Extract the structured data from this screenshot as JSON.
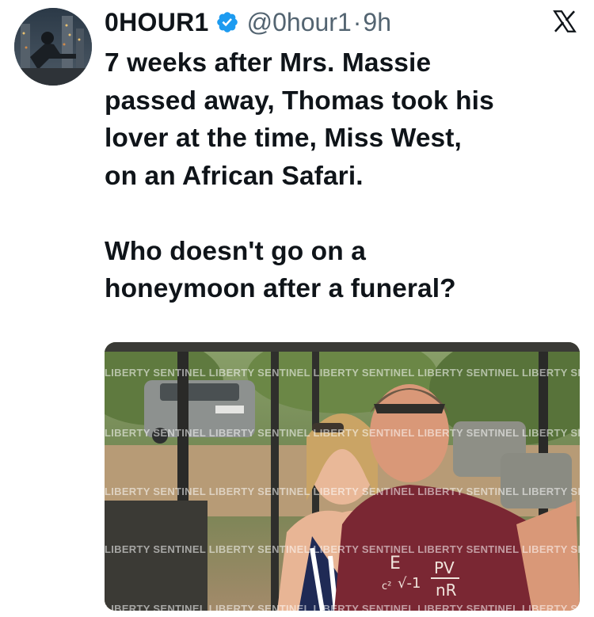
{
  "author": {
    "display_name": "0HOUR1",
    "handle": "@0hour1",
    "separator": "·",
    "time": "9h",
    "verified": true
  },
  "tweet": {
    "text": "7 weeks after Mrs. Massie\npassed away, Thomas took his\nlover at the time, Miss West,\non an African Safari.\n\nWho doesn't go on a\nhoneymoon after a funeral?"
  },
  "media": {
    "watermark_rows": [
      "LIBERTY SENTINEL  LIBERTY SENTINEL  LIBERTY SENTINEL  LIBERTY SENTINEL  LIBERTY SENTI",
      "LIBERTY SENTINEL  LIBERTY SENTINEL  LIBERTY SENTINEL  LIBERTY SENTINEL  LIBERTY SENTI",
      "LIBERTY SENTINEL  LIBERTY SENTINEL  LIBERTY SENTINEL  LIBERTY SENTINEL  LIBERTY SENTI",
      "LIBERTY SENTINEL  LIBERTY SENTINEL  LIBERTY SENTINEL  LIBERTY SENTINEL  LIBERTY SENTI",
      "LIBERTY SENTINEL  LIBERTY SENTINEL  LIBERTY SENTINEL  LIBERTY SENTINEL  LIBERTY SENTI"
    ],
    "shirt_text": [
      "E",
      "c²",
      "√-1",
      "PV",
      "nR"
    ]
  },
  "colors": {
    "verified_blue": "#1d9bf0",
    "text_primary": "#0f1419",
    "text_secondary": "#536471"
  },
  "icons": {
    "verified": "verified-badge-icon",
    "platform": "x-logo-icon"
  }
}
